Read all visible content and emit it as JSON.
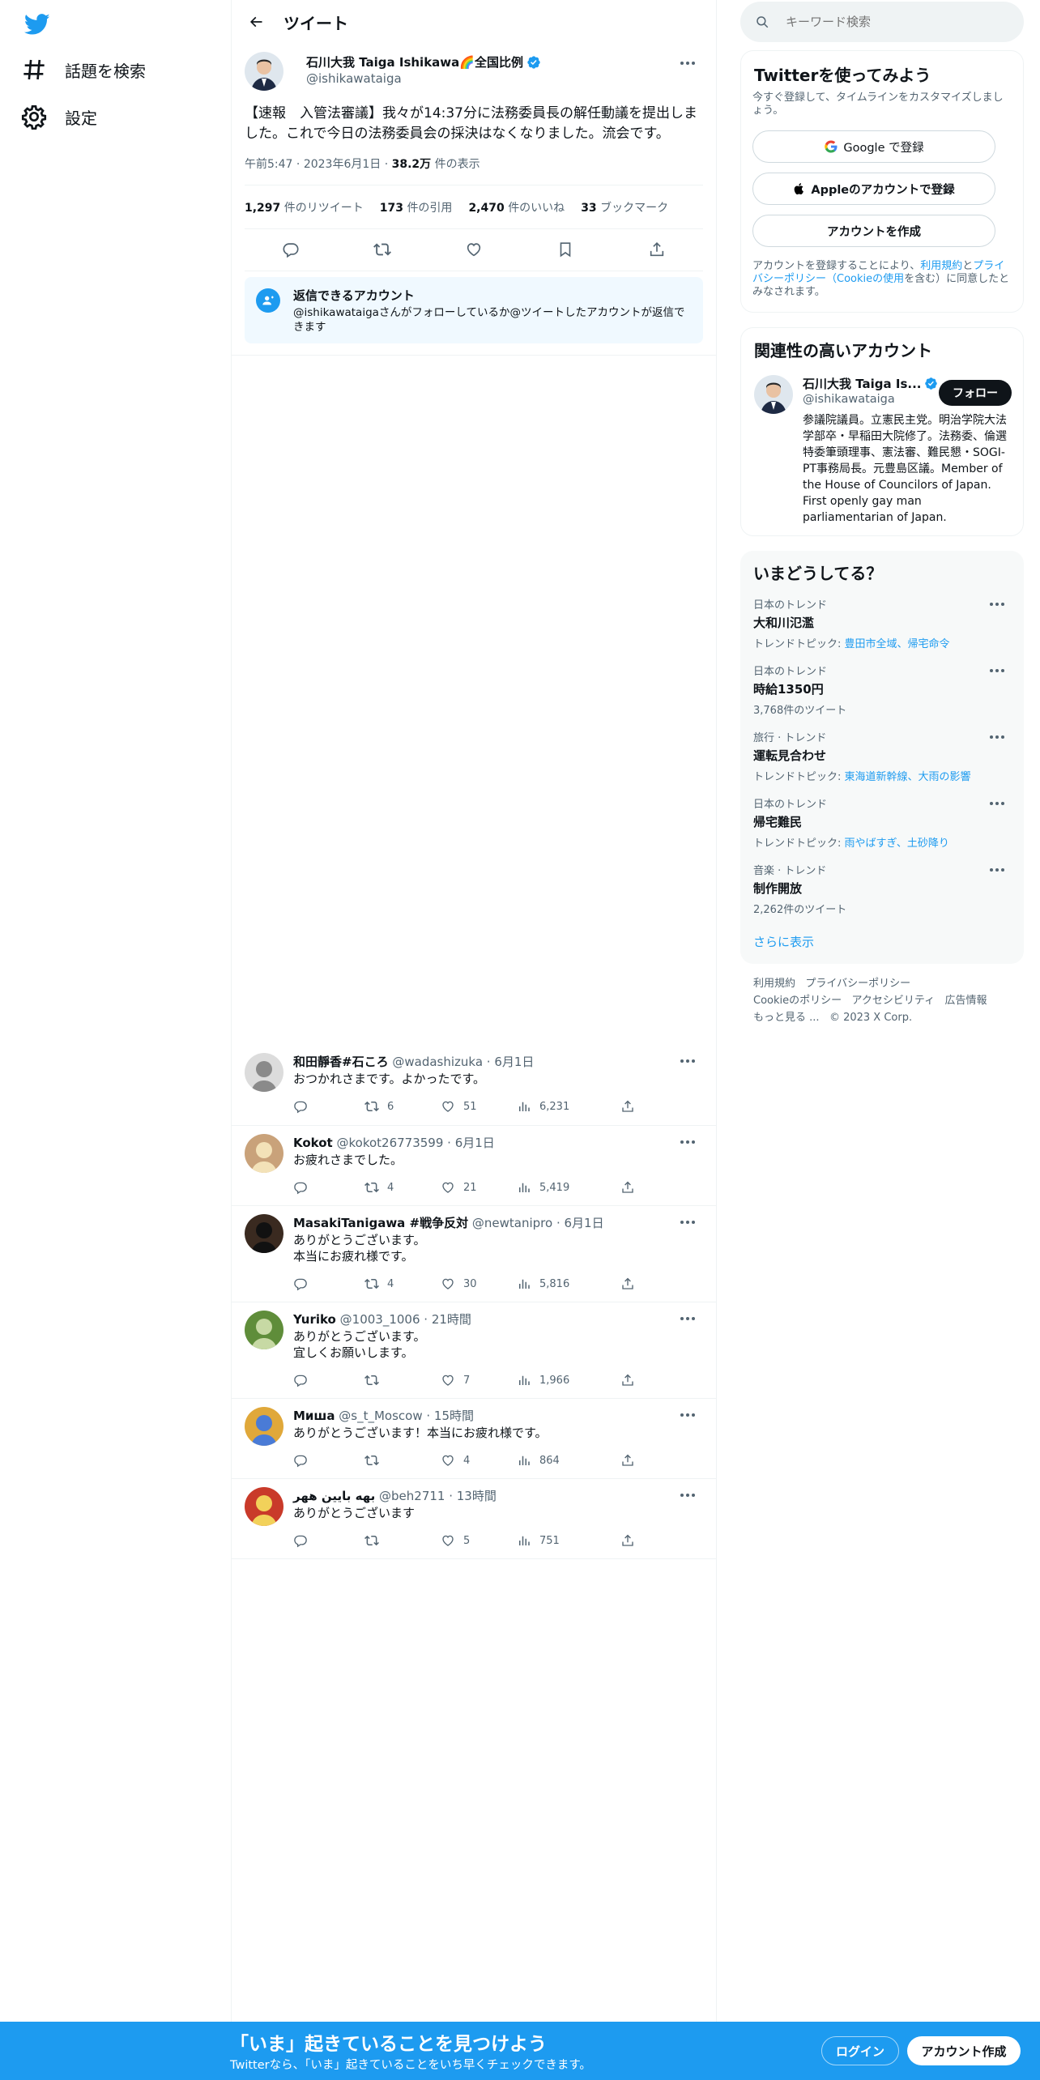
{
  "colors": {
    "accent": "#1d9bf0",
    "text": "#0f1419",
    "secondary": "#536471",
    "border": "#eff3f4"
  },
  "nav": {
    "logo_icon": "twitter-bird-icon",
    "explore_label": "話題を検索",
    "settings_label": "設定"
  },
  "header": {
    "title": "ツイート"
  },
  "tweet": {
    "name": "石川大我 Taiga Ishikawa🌈全国比例",
    "handle": "@ishikawataiga",
    "text": "【速報　入管法審議】我々が14:37分に法務委員長の解任動議を提出しました。これで今日の法務委員会の採決はなくなりました。流会です。",
    "time": "午前5:47",
    "date": "2023年6月1日",
    "views_count": "38.2万",
    "views_label": "件の表示",
    "stats": {
      "retweets": "1,297",
      "retweets_label": "件のリツイート",
      "quotes": "173",
      "quotes_label": "件の引用",
      "likes": "2,470",
      "likes_label": "件のいいね",
      "bookmarks": "33",
      "bookmarks_label": "ブックマーク"
    },
    "reply_restriction": {
      "title": "返信できるアカウント",
      "text": "@ishikawataigaさんがフォローしているか@ツイートしたアカウントが返信できます"
    }
  },
  "replies": [
    {
      "name": "和田靜香#石ころ",
      "handle": "@wadashizuka",
      "time": "6月1日",
      "text": "おつかれさまです。よかったです。",
      "retweets": "6",
      "likes": "51",
      "views": "6,231"
    },
    {
      "name": "Kokot",
      "handle": "@kokot26773599",
      "time": "6月1日",
      "text": "お疲れさまでした。",
      "retweets": "4",
      "likes": "21",
      "views": "5,419"
    },
    {
      "name": "MasakiTanigawa #戦争反対",
      "handle": "@newtanipro",
      "time": "6月1日",
      "text": "ありがとうございます。\n本当にお疲れ様です。",
      "retweets": "4",
      "likes": "30",
      "views": "5,816"
    },
    {
      "name": "Yuriko",
      "handle": "@1003_1006",
      "time": "21時間",
      "text": "ありがとうございます。\n宜しくお願いします。",
      "retweets": "",
      "likes": "7",
      "views": "1,966"
    },
    {
      "name": "Миша",
      "handle": "@s_t_Moscow",
      "time": "15時間",
      "text": "ありがとうございます！本当にお疲れ様です。",
      "retweets": "",
      "likes": "4",
      "views": "864"
    },
    {
      "name": "بهه بایین ههر",
      "handle": "@beh2711",
      "time": "13時間",
      "text": "ありがとうございます",
      "retweets": "",
      "likes": "5",
      "views": "751"
    }
  ],
  "search": {
    "placeholder": "キーワード検索"
  },
  "signup_card": {
    "title": "Twitterを使ってみよう",
    "subtitle": "今すぐ登録して、タイムラインをカスタマイズしましょう。",
    "google_label": "Google で登録",
    "apple_label": "Appleのアカウントで登録",
    "create_label": "アカウントを作成",
    "terms_prefix": "アカウントを登録することにより、",
    "terms_link": "利用規約",
    "terms_and": "と",
    "privacy_link": "プライバシーポリシー",
    "cookie_link": "（Cookieの使用",
    "terms_suffix": "を含む）に同意したとみなされます。"
  },
  "related": {
    "title": "関連性の高いアカウント",
    "name": "石川大我 Taiga Is...",
    "handle": "@ishikawataiga",
    "follow_label": "フォロー",
    "bio": "参議院議員。立憲民主党。明治学院大法学部卒・早稲田大院修了。法務委、倫選特委筆頭理事、憲法審、難民懇・SOGI-PT事務局長。元豊島区議。Member of the House of Councilors of Japan. First openly gay man parliamentarian of Japan."
  },
  "trends": {
    "title": "いまどうしてる？",
    "items": [
      {
        "category": "日本のトレンド",
        "name": "大和川氾濫",
        "topic_prefix": "トレンドトピック: ",
        "topic": "豊田市全域、帰宅命令"
      },
      {
        "category": "日本のトレンド",
        "name": "時給1350円",
        "topic_prefix": "",
        "topic": "3,768件のツイート"
      },
      {
        "category": "旅行 · トレンド",
        "name": "運転見合わせ",
        "topic_prefix": "トレンドトピック: ",
        "topic": "東海道新幹線、大雨の影響"
      },
      {
        "category": "日本のトレンド",
        "name": "帰宅難民",
        "topic_prefix": "トレンドトピック: ",
        "topic": "雨やばすぎ、土砂降り"
      },
      {
        "category": "音楽 · トレンド",
        "name": "制作開放",
        "topic_prefix": "",
        "topic": "2,262件のツイート"
      }
    ],
    "show_more": "さらに表示"
  },
  "footer": {
    "terms": "利用規約",
    "privacy": "プライバシーポリシー",
    "cookies": "Cookieのポリシー",
    "accessibility": "アクセシビリティ",
    "ads": "広告情報",
    "more": "もっと見る ...",
    "copyright": "© 2023 X Corp."
  },
  "bottom_bar": {
    "title": "「いま」起きていることを見つけよう",
    "subtitle": "Twitterなら、「いま」起きていることをいち早くチェックできます。",
    "login": "ログイン",
    "signup": "アカウント作成"
  }
}
